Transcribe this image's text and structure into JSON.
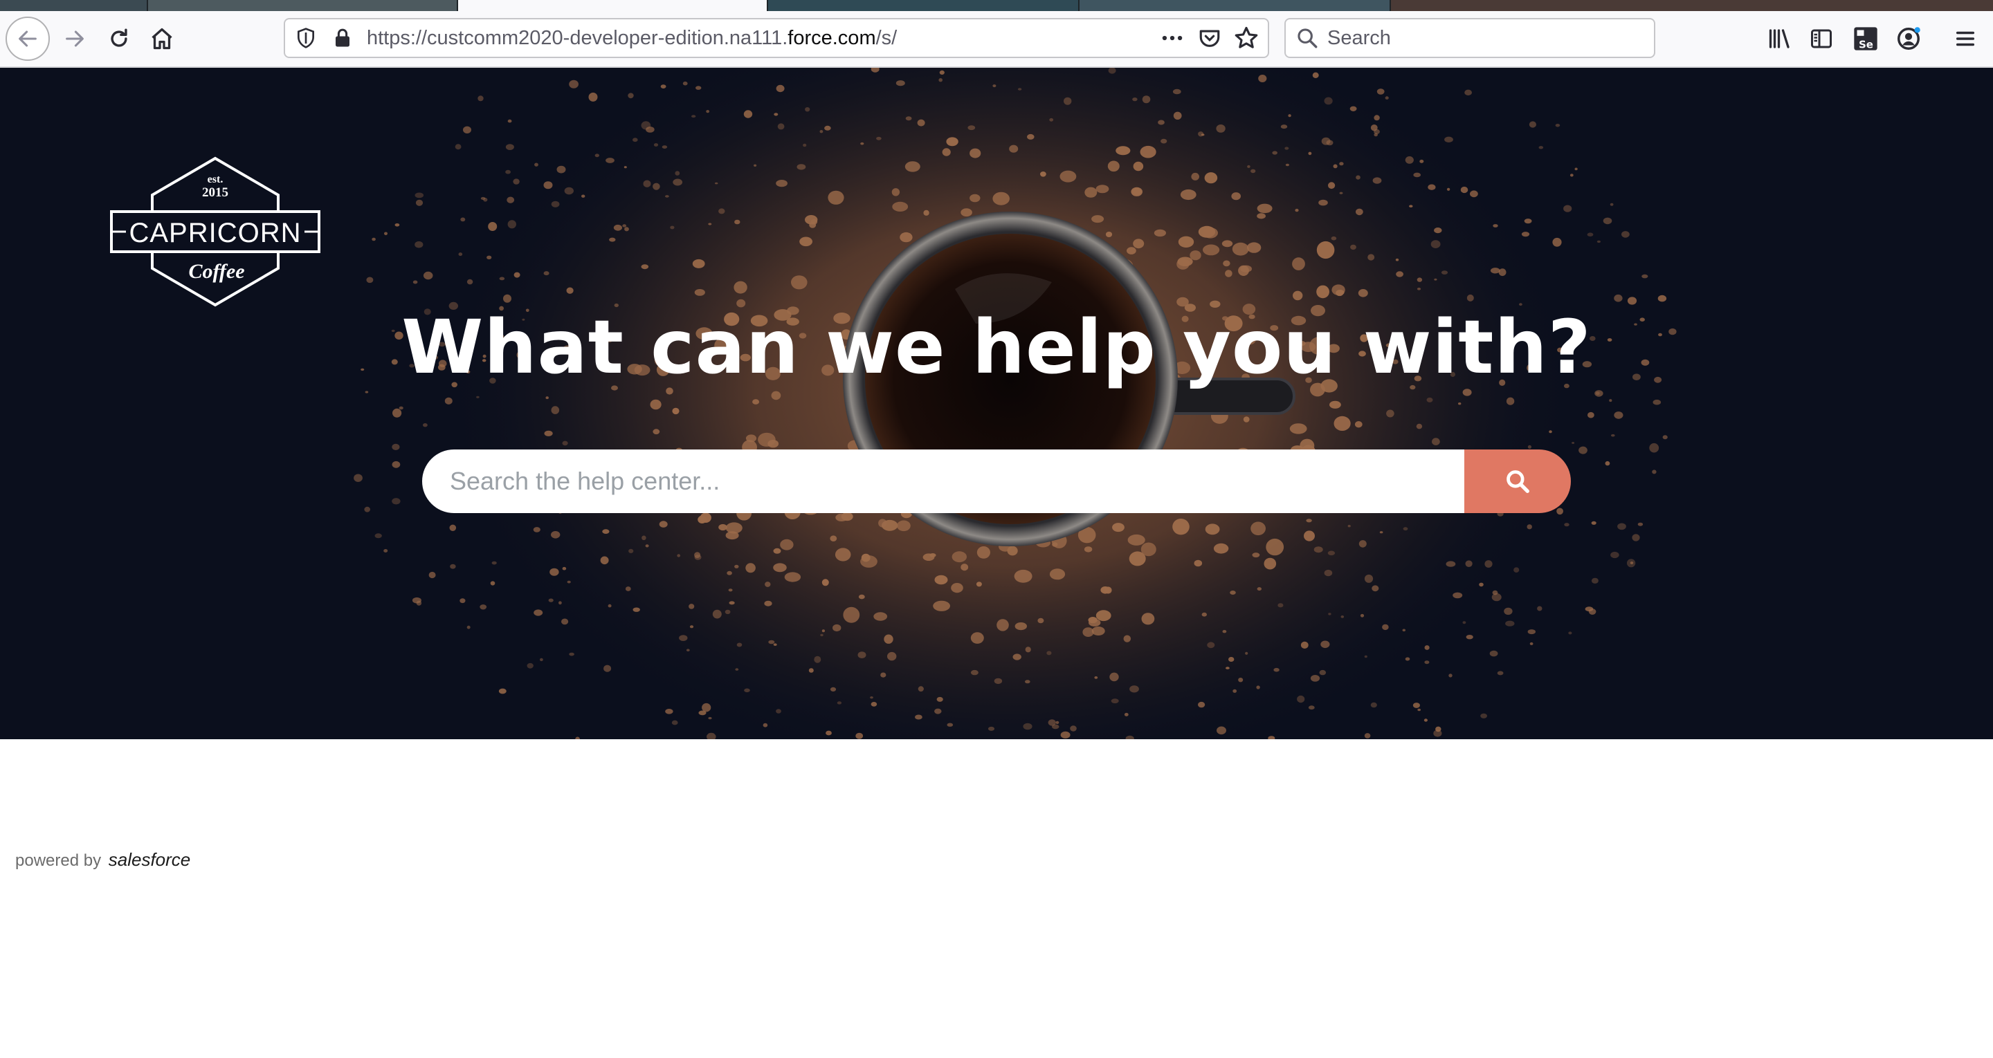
{
  "browser": {
    "url_prefix": "https://custcomm2020-developer-edition.na111.",
    "url_domain": "force.com",
    "url_suffix": "/s/",
    "search_placeholder": "Search",
    "icons": [
      "back-arrow-icon",
      "forward-arrow-icon",
      "reload-icon",
      "home-icon",
      "shield-icon",
      "lock-icon",
      "more-dots-icon",
      "pocket-icon",
      "bookmark-star-icon",
      "search-icon",
      "library-icon",
      "sidebar-icon",
      "selenium-icon",
      "account-icon",
      "menu-icon"
    ]
  },
  "logo": {
    "est": "est.",
    "year": "2015",
    "name": "CAPRICORN",
    "tagline": "Coffee"
  },
  "hero": {
    "headline": "What can we help you with?",
    "search_placeholder": "Search the help center...",
    "search_button_icon": "search-icon",
    "accent_color": "#e07863"
  },
  "footer": {
    "powered_by": "powered by",
    "brand": "salesforce"
  }
}
